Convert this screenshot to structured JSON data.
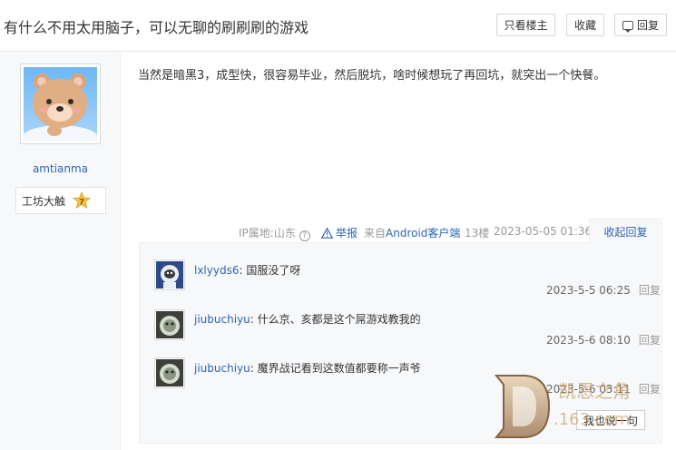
{
  "thread": {
    "title": "有什么不用太用脑子，可以无聊的刷刷刷的游戏",
    "only_op_label": "只看楼主",
    "favorite_label": "收藏",
    "reply_label": "回复"
  },
  "author": {
    "username": "amtianma",
    "forum_rank": "工坊大触",
    "level": "7"
  },
  "post": {
    "content": "当然是暗黑3，成型快，很容易毕业，然后脱坑，啥时候想玩了再回坑，就突出一个快餐。",
    "ip_location": "IP属地:山东",
    "report_label": "举报",
    "client_prefix": "来自",
    "client_link": "Android客户端",
    "floor": "13楼",
    "time": "2023-05-05 01:36",
    "collapse_label": "收起回复"
  },
  "replies": [
    {
      "user": "lxlyyds6",
      "text": ": 国服没了呀",
      "time": "2023-5-5 06:25",
      "action": "回复"
    },
    {
      "user": "jiubuchiyu",
      "text": ": 什么京、亥都是这个屌游戏教我的",
      "time": "2023-5-6 08:10",
      "action": "回复"
    },
    {
      "user": "jiubuchiyu",
      "text": ": 魔界战记看到这数值都要称一声爷",
      "time": "2023-5-6 03:11",
      "action": "回复"
    }
  ],
  "say_button": "我也说一句",
  "watermark": {
    "brand": "凯恩之角",
    "domain": ".163.com"
  },
  "colors": {
    "link": "#2d64b3",
    "muted": "#999999",
    "panel": "#f7f8fa"
  }
}
